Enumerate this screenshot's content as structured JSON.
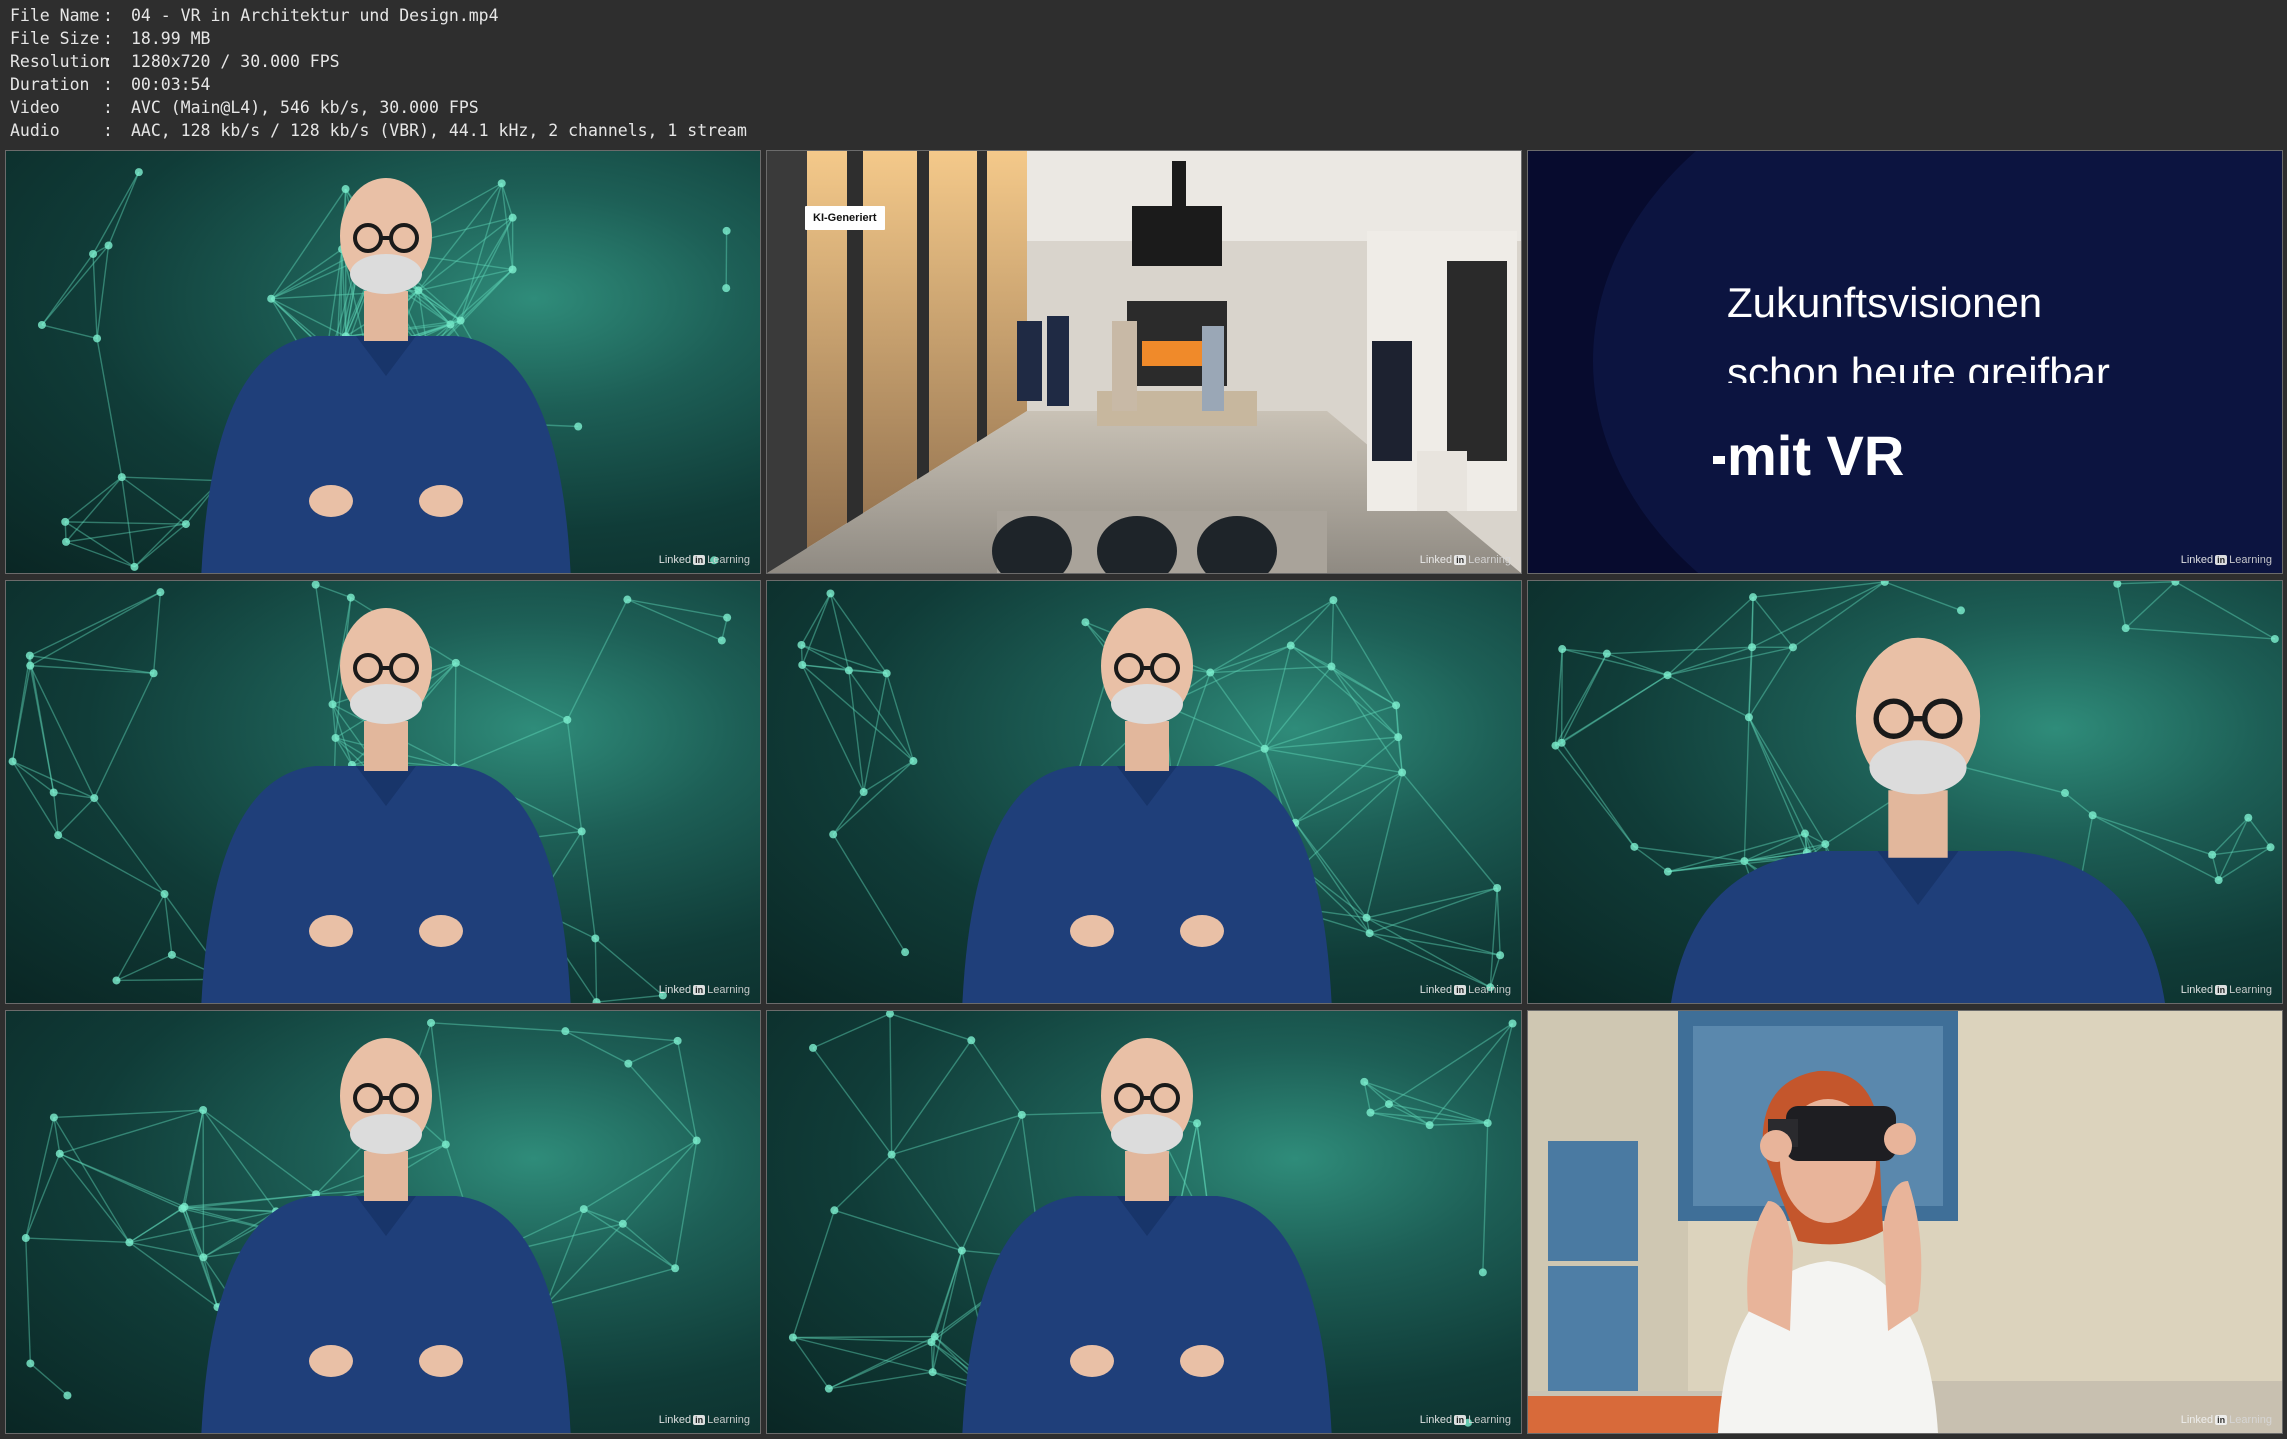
{
  "info": {
    "rows": [
      {
        "key": "File Name",
        "sep": ":",
        "value": "04 - VR in Architektur und Design.mp4"
      },
      {
        "key": "File Size",
        "sep": ":",
        "value": "18.99 MB"
      },
      {
        "key": "Resolution",
        "sep": ":",
        "value": "1280x720 / 30.000 FPS"
      },
      {
        "key": "Duration",
        "sep": ":",
        "value": "00:03:54"
      },
      {
        "key": "Video",
        "sep": ":",
        "value": "AVC (Main@L4), 546 kb/s, 30.000 FPS"
      },
      {
        "key": "Audio",
        "sep": ":",
        "value": "AAC, 128 kb/s / 128 kb/s (VBR), 44.1 kHz, 2 channels, 1 stream"
      }
    ]
  },
  "watermark": {
    "linked": "Linked",
    "in": "in",
    "learning": "Learning"
  },
  "thumbs": {
    "interior": {
      "badge": "KI-Generiert"
    },
    "title_card": {
      "line1": "Zukunftsvisionen",
      "line2": "schon heute greifbar",
      "line3": "mit VR"
    }
  },
  "colors": {
    "background": "#2e2e2e",
    "teal_bg": "#1d5f56",
    "title_card_bg": "#070b2e",
    "shirt_blue": "#1f3f7a"
  }
}
